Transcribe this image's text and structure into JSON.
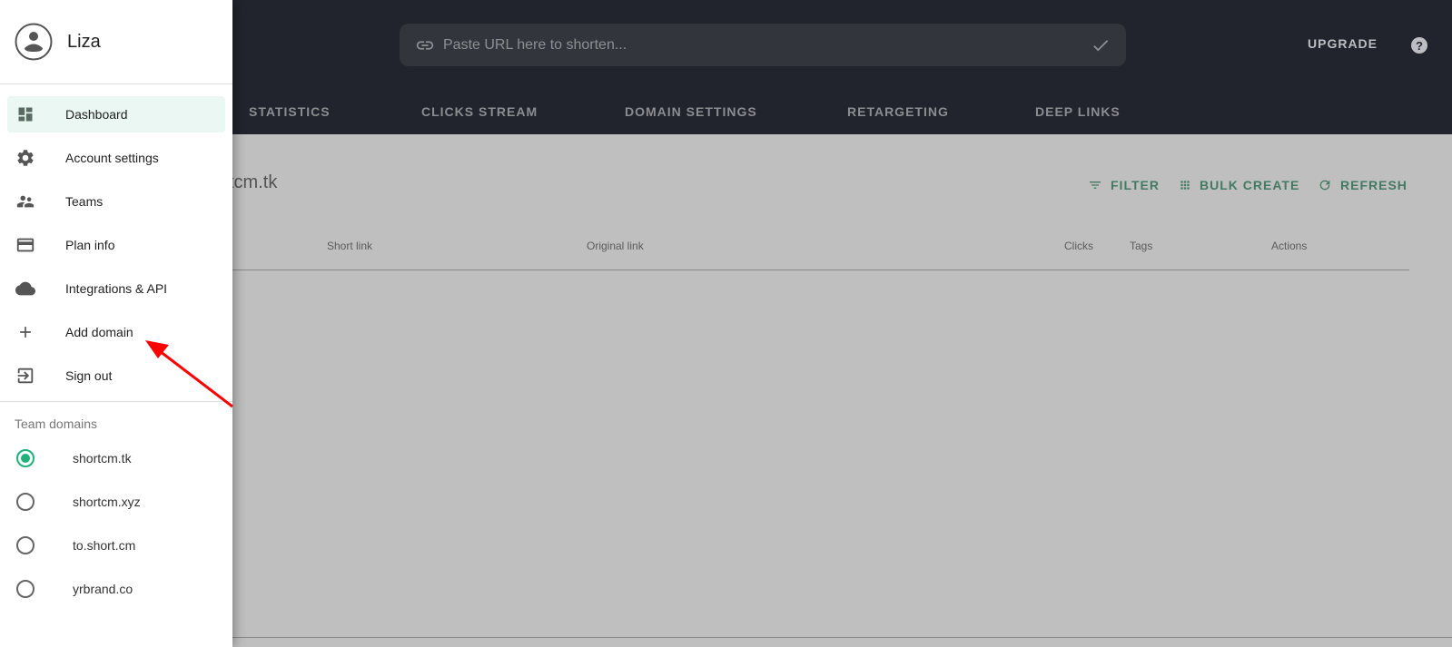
{
  "header": {
    "url_placeholder": "Paste URL here to shorten...",
    "upgrade_label": "UPGRADE",
    "help_label": "?",
    "icons": {
      "link": "link-icon",
      "submit": "check-icon",
      "help": "help-icon"
    }
  },
  "tabs": [
    {
      "label": "STATISTICS"
    },
    {
      "label": "CLICKS STREAM"
    },
    {
      "label": "DOMAIN SETTINGS"
    },
    {
      "label": "RETARGETING"
    },
    {
      "label": "DEEP LINKS"
    }
  ],
  "content": {
    "title_visible": "tcm.tk",
    "actions": [
      {
        "label": "FILTER",
        "icon": "filter-icon"
      },
      {
        "label": "BULK CREATE",
        "icon": "grid-icon"
      },
      {
        "label": "REFRESH",
        "icon": "refresh-icon"
      }
    ],
    "table_headers": [
      "Short link",
      "Original link",
      "Clicks",
      "Tags",
      "Actions"
    ]
  },
  "drawer": {
    "user_name": "Liza",
    "menu": [
      {
        "label": "Dashboard",
        "icon": "dashboard-icon",
        "active": true
      },
      {
        "label": "Account settings",
        "icon": "gear-icon"
      },
      {
        "label": "Teams",
        "icon": "people-icon"
      },
      {
        "label": "Plan info",
        "icon": "credit-card-icon"
      },
      {
        "label": "Integrations & API",
        "icon": "cloud-icon"
      },
      {
        "label": "Add domain",
        "icon": "plus-icon"
      },
      {
        "label": "Sign out",
        "icon": "sign-out-icon"
      }
    ],
    "team_domains_label": "Team domains",
    "domains": [
      {
        "label": "shortcm.tk",
        "selected": true
      },
      {
        "label": "shortcm.xyz",
        "selected": false
      },
      {
        "label": "to.short.cm",
        "selected": false
      },
      {
        "label": "yrbrand.co",
        "selected": false
      }
    ]
  },
  "colors": {
    "header_bg": "#21242d",
    "accent_green": "#1a7a52",
    "radio_selected": "#1fb27a",
    "annotation_arrow": "#ff0000"
  }
}
